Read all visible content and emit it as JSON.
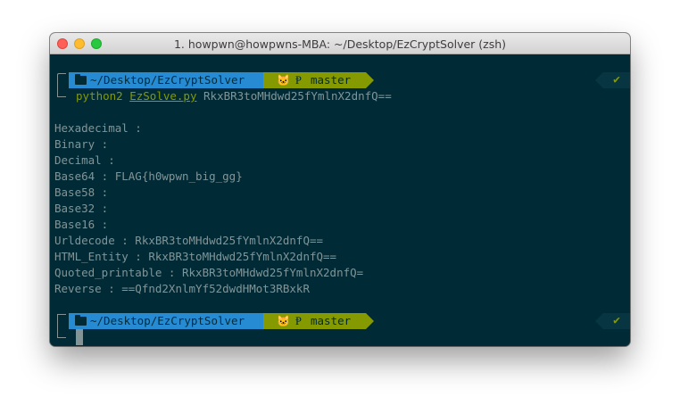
{
  "window": {
    "title": "1. howpwn@howpwns-MBA: ~/Desktop/EzCryptSolver (zsh)"
  },
  "prompt1": {
    "path": "~/Desktop/EzCryptSolver",
    "octocat": "🐱",
    "branch_symbol": "Ᵽ",
    "branch": "master",
    "status": "✔"
  },
  "command": {
    "program": "python2",
    "script": "EzSolve.py",
    "argument": "RkxBR3toMHdwd25fYmlnX2dnfQ=="
  },
  "output": [
    "Hexadecimal :",
    "Binary :",
    "Decimal :",
    "Base64 : FLAG{h0wpwn_big_gg}",
    "Base58 :",
    "Base32 :",
    "Base16 :",
    "Urldecode : RkxBR3toMHdwd25fYmlnX2dnfQ==",
    "HTML_Entity : RkxBR3toMHdwd25fYmlnX2dnfQ==",
    "Quoted_printable : RkxBR3toMHdwd25fYmlnX2dnfQ=",
    "Reverse : ==Qfnd2XnlmYf52dwdHMot3RBxkR"
  ],
  "prompt2": {
    "path": "~/Desktop/EzCryptSolver",
    "octocat": "🐱",
    "branch_symbol": "Ᵽ",
    "branch": "master",
    "status": "✔"
  },
  "colors": {
    "background": "#002b36",
    "dir_segment": "#268bd2",
    "git_segment": "#859900",
    "text": "#839496"
  }
}
